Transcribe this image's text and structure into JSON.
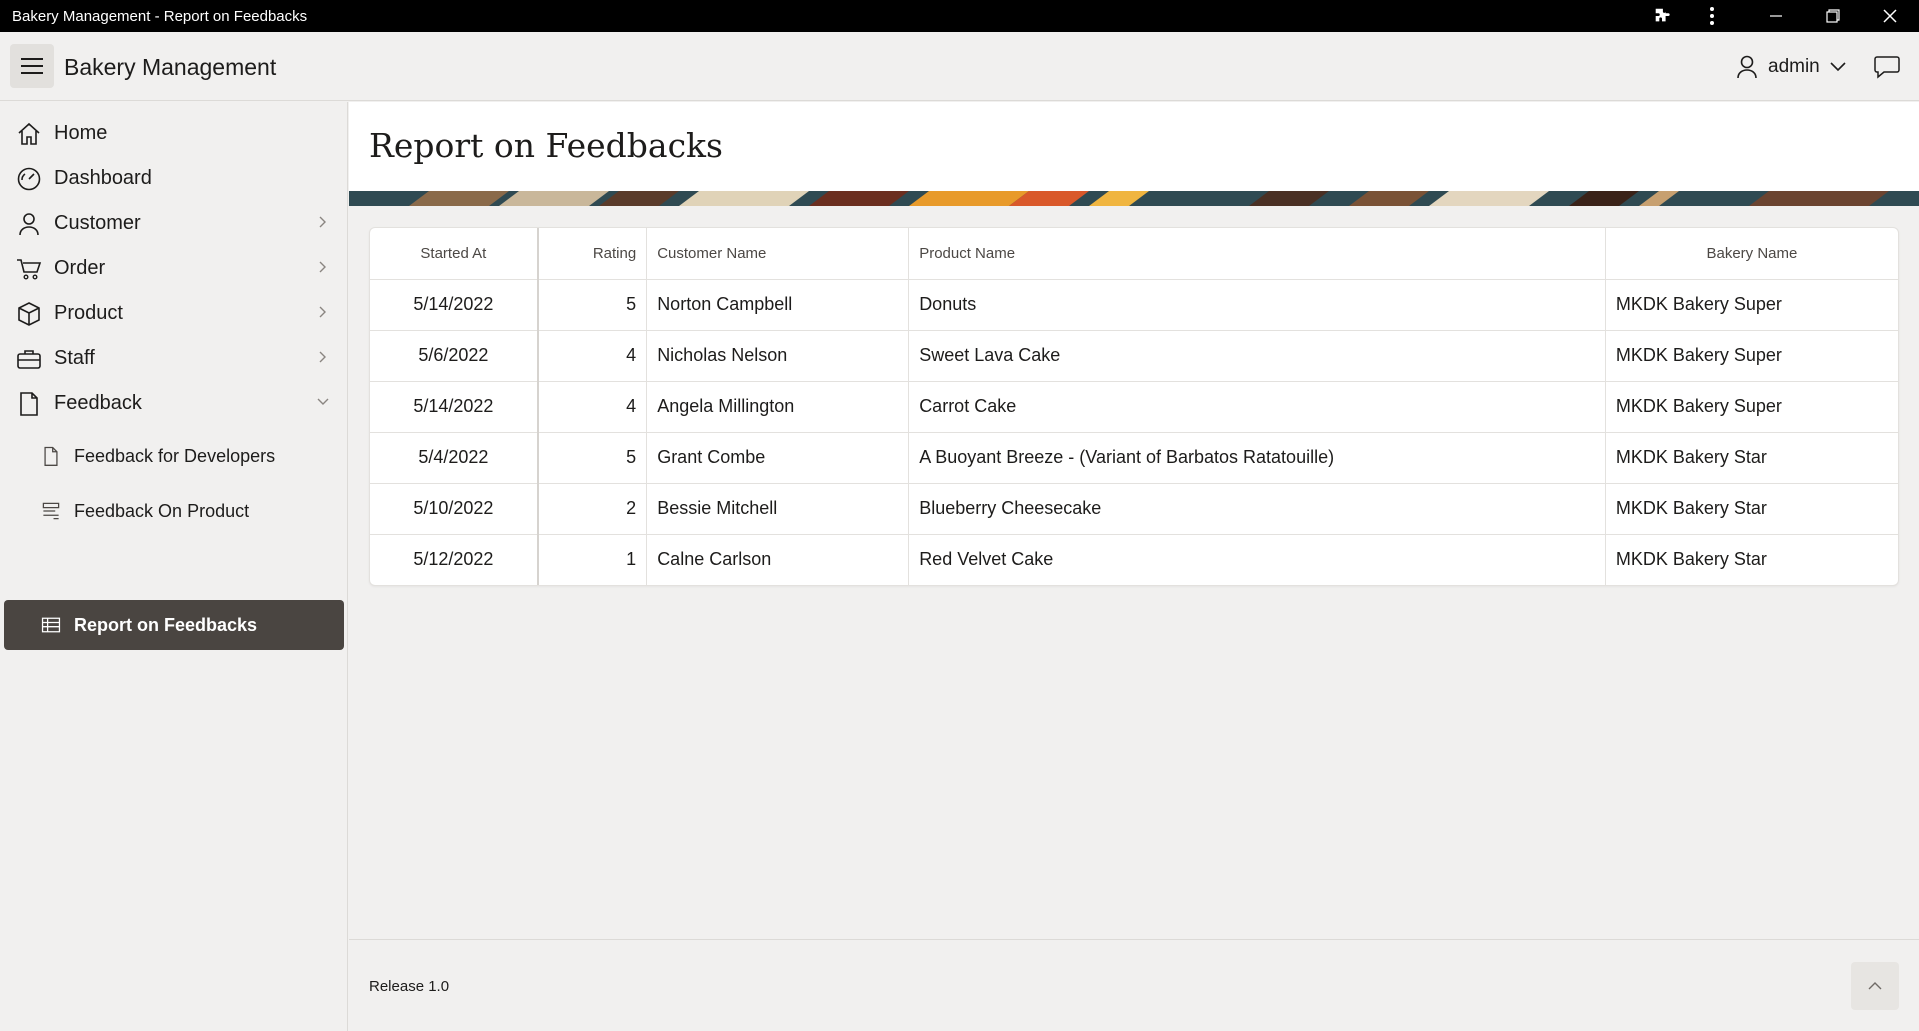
{
  "window": {
    "title": "Bakery Management - Report on Feedbacks"
  },
  "header": {
    "app_title": "Bakery Management",
    "user": "admin"
  },
  "sidebar": {
    "items": [
      {
        "label": "Home",
        "icon": "home-icon"
      },
      {
        "label": "Dashboard",
        "icon": "dashboard-icon"
      },
      {
        "label": "Customer",
        "icon": "user-icon",
        "expandable": true
      },
      {
        "label": "Order",
        "icon": "cart-icon",
        "expandable": true
      },
      {
        "label": "Product",
        "icon": "box-icon",
        "expandable": true
      },
      {
        "label": "Staff",
        "icon": "briefcase-icon",
        "expandable": true
      },
      {
        "label": "Feedback",
        "icon": "document-icon",
        "expanded": true
      },
      {
        "label": "Feedback for Developers",
        "icon": "document-icon"
      },
      {
        "label": "Feedback On Product",
        "icon": "form-icon"
      },
      {
        "label": "Report on Feedbacks",
        "icon": "report-icon",
        "active": true
      }
    ]
  },
  "page": {
    "title": "Report on Feedbacks"
  },
  "report": {
    "columns": [
      "Started At",
      "Rating",
      "Customer Name",
      "Product Name",
      "Bakery Name"
    ],
    "rows": [
      [
        "5/14/2022",
        "5",
        "Norton Campbell",
        "Donuts",
        "MKDK Bakery Super"
      ],
      [
        "5/6/2022",
        "4",
        "Nicholas Nelson",
        "Sweet Lava Cake",
        "MKDK Bakery Super"
      ],
      [
        "5/14/2022",
        "4",
        "Angela Millington",
        "Carrot Cake",
        "MKDK Bakery Super"
      ],
      [
        "5/4/2022",
        "5",
        "Grant Combe",
        "A Buoyant Breeze - (Variant of Barbatos Ratatouille)",
        "MKDK Bakery Star"
      ],
      [
        "5/10/2022",
        "2",
        "Bessie Mitchell",
        "Blueberry Cheesecake",
        "MKDK Bakery Star"
      ],
      [
        "5/12/2022",
        "1",
        "Calne Carlson",
        "Red Velvet Cake",
        "MKDK Bakery Star"
      ]
    ]
  },
  "footer": {
    "release": "Release 1.0"
  },
  "colors": {
    "active_nav": "#4a4541",
    "background": "#f1f0ef",
    "titlebar": "#000000"
  }
}
